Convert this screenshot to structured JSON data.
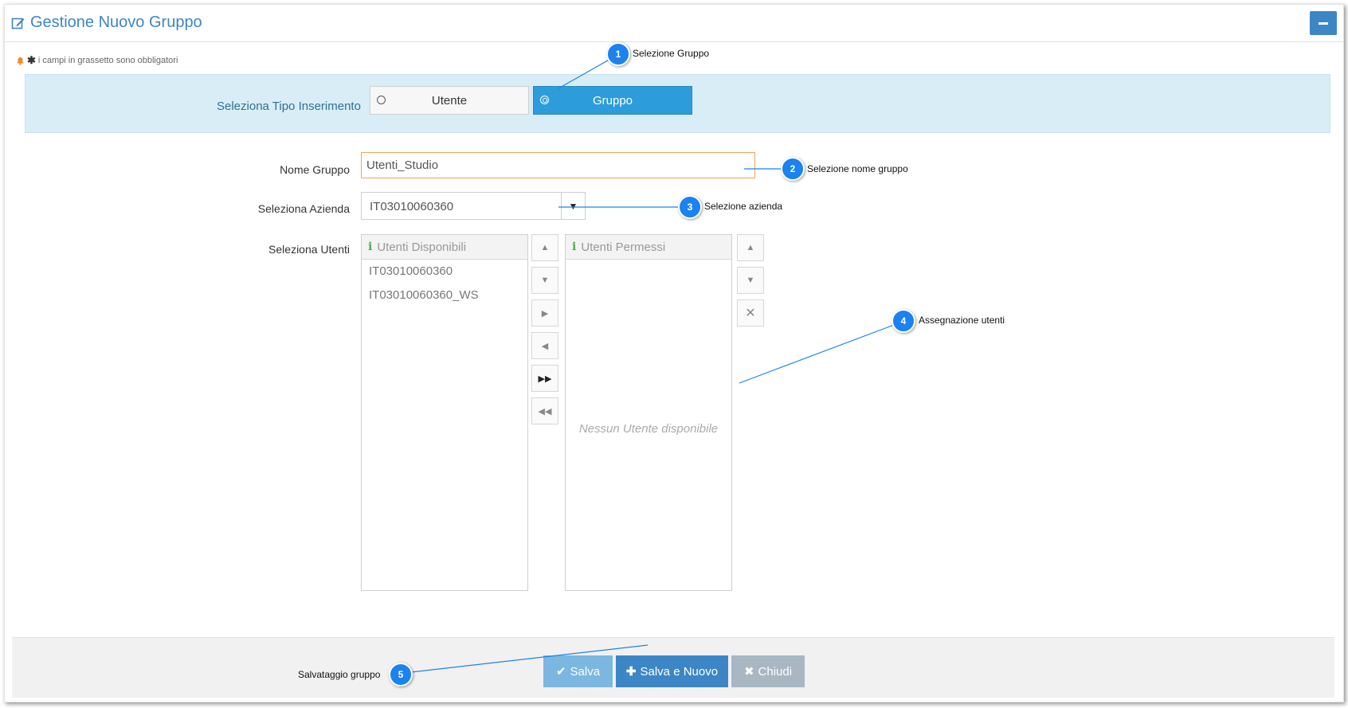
{
  "header": {
    "title": "Gestione Nuovo Gruppo",
    "minimize_label": "–"
  },
  "note": {
    "text": "i campi in grassetto sono obbligatori"
  },
  "tipo": {
    "label": "Seleziona Tipo Inserimento",
    "options": [
      "Utente",
      "Gruppo"
    ],
    "selected": "Gruppo"
  },
  "form": {
    "nome_label": "Nome Gruppo",
    "nome_value": "Utenti_Studio",
    "azienda_label": "Seleziona Azienda",
    "azienda_value": "IT03010060360",
    "utenti_label": "Seleziona Utenti"
  },
  "lists": {
    "available_title": "Utenti Disponibili",
    "available_items": [
      "IT03010060360",
      "IT03010060360_WS"
    ],
    "permitted_title": "Utenti Permessi",
    "permitted_empty": "Nessun Utente disponibile"
  },
  "footer": {
    "save": "Salva",
    "save_new": "Salva e Nuovo",
    "close": "Chiudi"
  },
  "callouts": [
    {
      "n": "1",
      "text": "Selezione Gruppo"
    },
    {
      "n": "2",
      "text": "Selezione nome gruppo"
    },
    {
      "n": "3",
      "text": "Selezione azienda"
    },
    {
      "n": "4",
      "text": "Assegnazione utenti"
    },
    {
      "n": "5",
      "text": "Salvataggio gruppo"
    }
  ],
  "colors": {
    "accent": "#3d86c6",
    "selected": "#2d9cdb",
    "callout": "#1b82f0",
    "focus_border": "#f0a35a"
  }
}
